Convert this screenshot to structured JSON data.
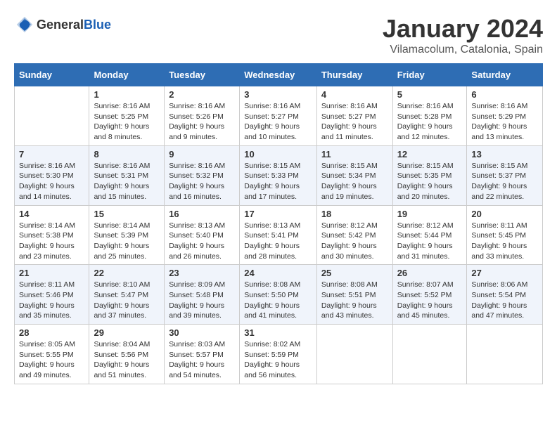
{
  "header": {
    "logo_general": "General",
    "logo_blue": "Blue",
    "title": "January 2024",
    "subtitle": "Vilamacolum, Catalonia, Spain"
  },
  "columns": [
    "Sunday",
    "Monday",
    "Tuesday",
    "Wednesday",
    "Thursday",
    "Friday",
    "Saturday"
  ],
  "weeks": [
    [
      {
        "day": "",
        "sunrise": "",
        "sunset": "",
        "daylight": ""
      },
      {
        "day": "1",
        "sunrise": "Sunrise: 8:16 AM",
        "sunset": "Sunset: 5:25 PM",
        "daylight": "Daylight: 9 hours and 8 minutes."
      },
      {
        "day": "2",
        "sunrise": "Sunrise: 8:16 AM",
        "sunset": "Sunset: 5:26 PM",
        "daylight": "Daylight: 9 hours and 9 minutes."
      },
      {
        "day": "3",
        "sunrise": "Sunrise: 8:16 AM",
        "sunset": "Sunset: 5:27 PM",
        "daylight": "Daylight: 9 hours and 10 minutes."
      },
      {
        "day": "4",
        "sunrise": "Sunrise: 8:16 AM",
        "sunset": "Sunset: 5:27 PM",
        "daylight": "Daylight: 9 hours and 11 minutes."
      },
      {
        "day": "5",
        "sunrise": "Sunrise: 8:16 AM",
        "sunset": "Sunset: 5:28 PM",
        "daylight": "Daylight: 9 hours and 12 minutes."
      },
      {
        "day": "6",
        "sunrise": "Sunrise: 8:16 AM",
        "sunset": "Sunset: 5:29 PM",
        "daylight": "Daylight: 9 hours and 13 minutes."
      }
    ],
    [
      {
        "day": "7",
        "sunrise": "Sunrise: 8:16 AM",
        "sunset": "Sunset: 5:30 PM",
        "daylight": "Daylight: 9 hours and 14 minutes."
      },
      {
        "day": "8",
        "sunrise": "Sunrise: 8:16 AM",
        "sunset": "Sunset: 5:31 PM",
        "daylight": "Daylight: 9 hours and 15 minutes."
      },
      {
        "day": "9",
        "sunrise": "Sunrise: 8:16 AM",
        "sunset": "Sunset: 5:32 PM",
        "daylight": "Daylight: 9 hours and 16 minutes."
      },
      {
        "day": "10",
        "sunrise": "Sunrise: 8:15 AM",
        "sunset": "Sunset: 5:33 PM",
        "daylight": "Daylight: 9 hours and 17 minutes."
      },
      {
        "day": "11",
        "sunrise": "Sunrise: 8:15 AM",
        "sunset": "Sunset: 5:34 PM",
        "daylight": "Daylight: 9 hours and 19 minutes."
      },
      {
        "day": "12",
        "sunrise": "Sunrise: 8:15 AM",
        "sunset": "Sunset: 5:35 PM",
        "daylight": "Daylight: 9 hours and 20 minutes."
      },
      {
        "day": "13",
        "sunrise": "Sunrise: 8:15 AM",
        "sunset": "Sunset: 5:37 PM",
        "daylight": "Daylight: 9 hours and 22 minutes."
      }
    ],
    [
      {
        "day": "14",
        "sunrise": "Sunrise: 8:14 AM",
        "sunset": "Sunset: 5:38 PM",
        "daylight": "Daylight: 9 hours and 23 minutes."
      },
      {
        "day": "15",
        "sunrise": "Sunrise: 8:14 AM",
        "sunset": "Sunset: 5:39 PM",
        "daylight": "Daylight: 9 hours and 25 minutes."
      },
      {
        "day": "16",
        "sunrise": "Sunrise: 8:13 AM",
        "sunset": "Sunset: 5:40 PM",
        "daylight": "Daylight: 9 hours and 26 minutes."
      },
      {
        "day": "17",
        "sunrise": "Sunrise: 8:13 AM",
        "sunset": "Sunset: 5:41 PM",
        "daylight": "Daylight: 9 hours and 28 minutes."
      },
      {
        "day": "18",
        "sunrise": "Sunrise: 8:12 AM",
        "sunset": "Sunset: 5:42 PM",
        "daylight": "Daylight: 9 hours and 30 minutes."
      },
      {
        "day": "19",
        "sunrise": "Sunrise: 8:12 AM",
        "sunset": "Sunset: 5:44 PM",
        "daylight": "Daylight: 9 hours and 31 minutes."
      },
      {
        "day": "20",
        "sunrise": "Sunrise: 8:11 AM",
        "sunset": "Sunset: 5:45 PM",
        "daylight": "Daylight: 9 hours and 33 minutes."
      }
    ],
    [
      {
        "day": "21",
        "sunrise": "Sunrise: 8:11 AM",
        "sunset": "Sunset: 5:46 PM",
        "daylight": "Daylight: 9 hours and 35 minutes."
      },
      {
        "day": "22",
        "sunrise": "Sunrise: 8:10 AM",
        "sunset": "Sunset: 5:47 PM",
        "daylight": "Daylight: 9 hours and 37 minutes."
      },
      {
        "day": "23",
        "sunrise": "Sunrise: 8:09 AM",
        "sunset": "Sunset: 5:48 PM",
        "daylight": "Daylight: 9 hours and 39 minutes."
      },
      {
        "day": "24",
        "sunrise": "Sunrise: 8:08 AM",
        "sunset": "Sunset: 5:50 PM",
        "daylight": "Daylight: 9 hours and 41 minutes."
      },
      {
        "day": "25",
        "sunrise": "Sunrise: 8:08 AM",
        "sunset": "Sunset: 5:51 PM",
        "daylight": "Daylight: 9 hours and 43 minutes."
      },
      {
        "day": "26",
        "sunrise": "Sunrise: 8:07 AM",
        "sunset": "Sunset: 5:52 PM",
        "daylight": "Daylight: 9 hours and 45 minutes."
      },
      {
        "day": "27",
        "sunrise": "Sunrise: 8:06 AM",
        "sunset": "Sunset: 5:54 PM",
        "daylight": "Daylight: 9 hours and 47 minutes."
      }
    ],
    [
      {
        "day": "28",
        "sunrise": "Sunrise: 8:05 AM",
        "sunset": "Sunset: 5:55 PM",
        "daylight": "Daylight: 9 hours and 49 minutes."
      },
      {
        "day": "29",
        "sunrise": "Sunrise: 8:04 AM",
        "sunset": "Sunset: 5:56 PM",
        "daylight": "Daylight: 9 hours and 51 minutes."
      },
      {
        "day": "30",
        "sunrise": "Sunrise: 8:03 AM",
        "sunset": "Sunset: 5:57 PM",
        "daylight": "Daylight: 9 hours and 54 minutes."
      },
      {
        "day": "31",
        "sunrise": "Sunrise: 8:02 AM",
        "sunset": "Sunset: 5:59 PM",
        "daylight": "Daylight: 9 hours and 56 minutes."
      },
      {
        "day": "",
        "sunrise": "",
        "sunset": "",
        "daylight": ""
      },
      {
        "day": "",
        "sunrise": "",
        "sunset": "",
        "daylight": ""
      },
      {
        "day": "",
        "sunrise": "",
        "sunset": "",
        "daylight": ""
      }
    ]
  ]
}
